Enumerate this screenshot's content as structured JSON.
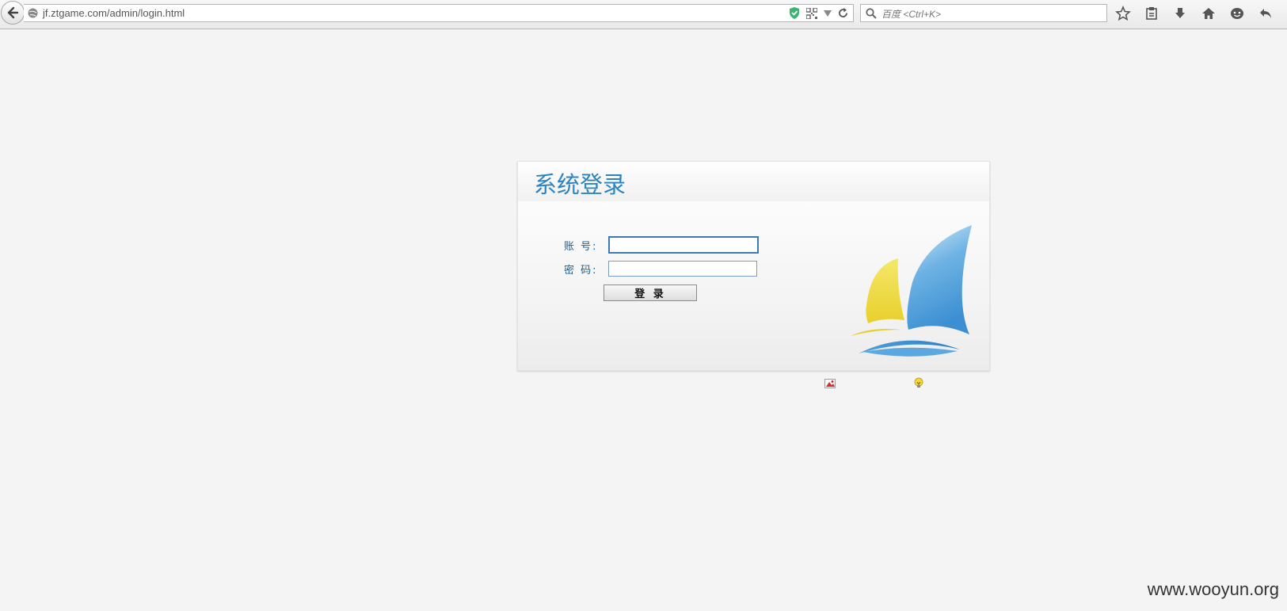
{
  "browser": {
    "url": "jf.ztgame.com/admin/login.html",
    "search_placeholder": "百度 <Ctrl+K>"
  },
  "login": {
    "title": "系统登录",
    "account_label": "账  号:",
    "password_label": "密  码:",
    "account_value": "",
    "password_value": "",
    "submit_label": "登 录"
  },
  "watermark": "www.wooyun.org",
  "icons": {
    "back": "back-arrow-icon",
    "site": "globe-icon",
    "shield": "shield-icon",
    "qr": "qr-code-icon",
    "dropdown": "dropdown-icon",
    "reload": "reload-icon",
    "search": "search-icon",
    "bookmark": "star-icon",
    "reading_list": "clipboard-icon",
    "download": "download-icon",
    "home": "home-icon",
    "chat": "smiley-icon",
    "undo": "undo-icon"
  },
  "colors": {
    "title_blue": "#2a84c4",
    "label_blue": "#1d5f8c",
    "page_bg": "#f4f4f4"
  }
}
